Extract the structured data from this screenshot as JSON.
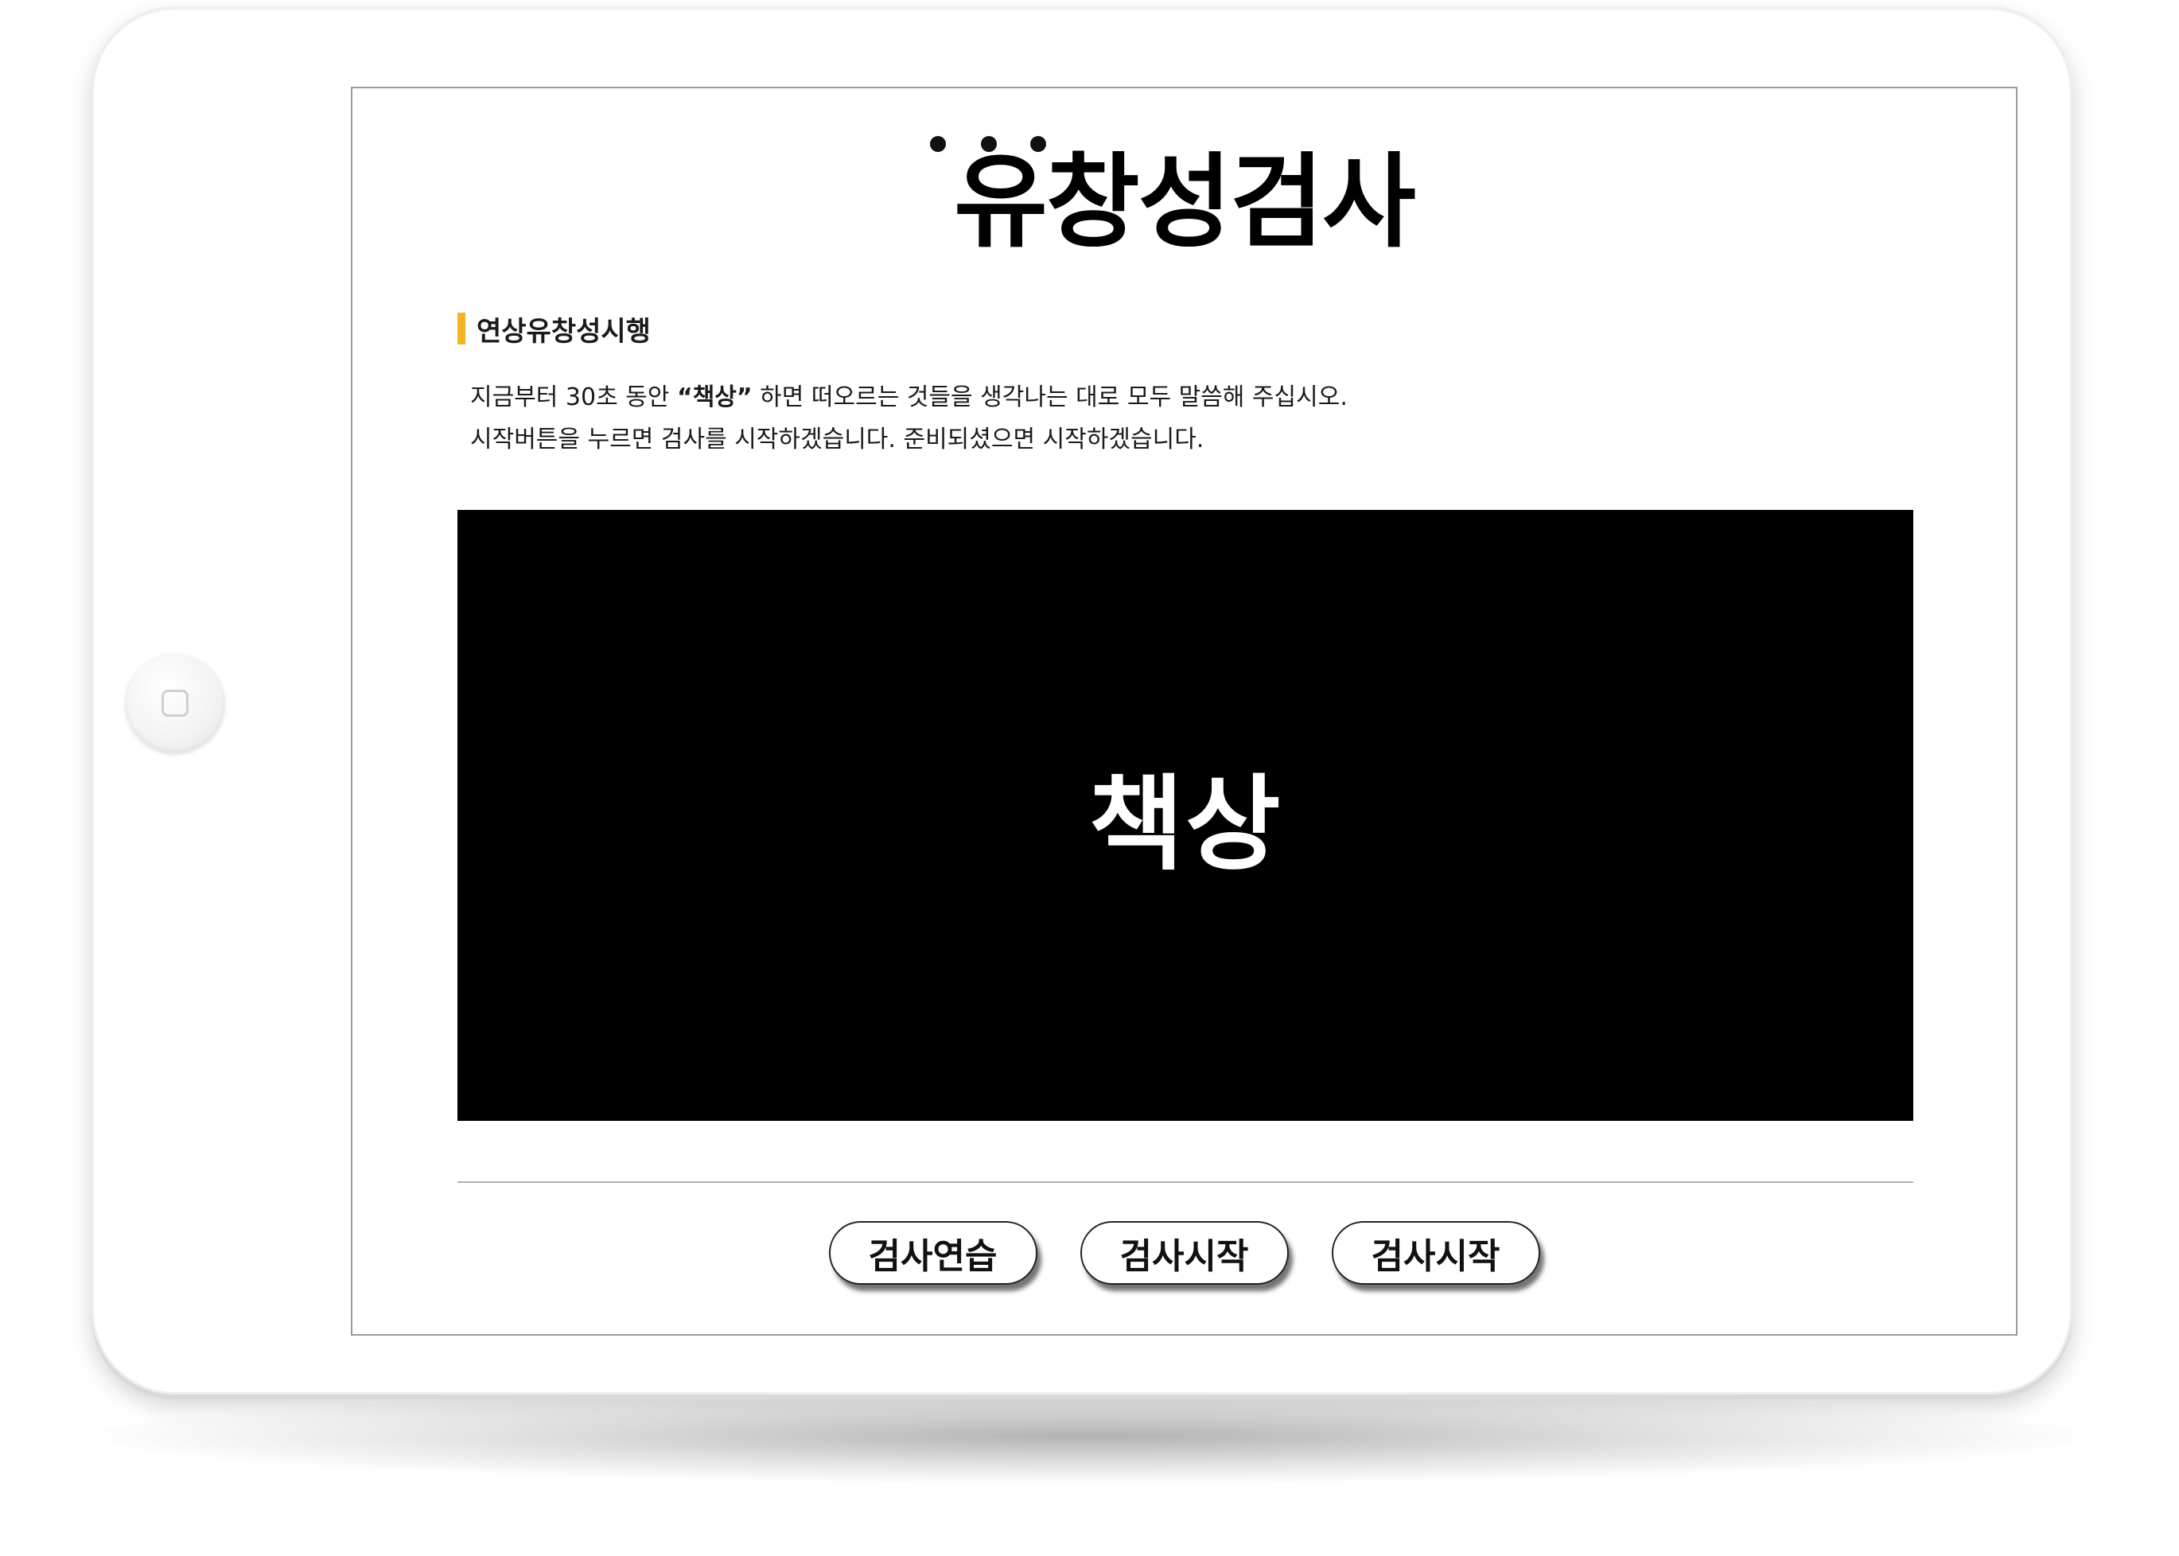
{
  "page": {
    "title": "유창성검사"
  },
  "section": {
    "heading": "연상유창성시행",
    "accent_color": "#f5b523"
  },
  "instructions": {
    "line1_before": "지금부터 30초 동안 ",
    "line1_keyword": "“책상”",
    "line1_after": " 하면 떠오르는 것들을 생각나는 대로 모두 말씀해 주십시오.",
    "line2": "시작버튼을 누르면 검사를 시작하겠습니다. 준비되셨으면 시작하겠습니다."
  },
  "stimulus": {
    "word": "책상",
    "background": "#000000",
    "text_color": "#ffffff"
  },
  "buttons": [
    {
      "label": "검사연습"
    },
    {
      "label": "검사시작"
    },
    {
      "label": "검사시작"
    }
  ],
  "device": {
    "home_button_icon": "home-square-icon",
    "camera_icon": "camera-icon"
  }
}
